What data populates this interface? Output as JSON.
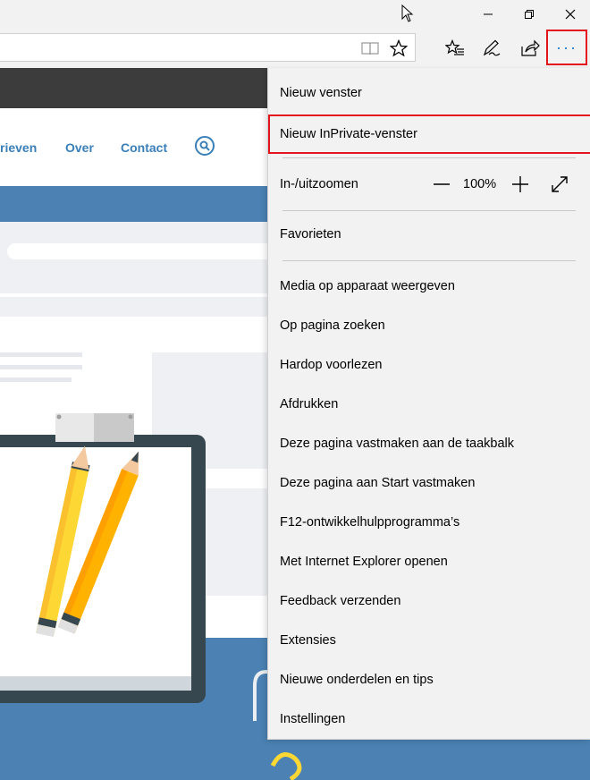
{
  "window": {
    "minimize_label": "Minimize",
    "restore_label": "Restore",
    "close_label": "Close"
  },
  "toolbar": {
    "more_label": "···"
  },
  "website": {
    "nav_links": [
      "rieven",
      "Over",
      "Contact"
    ]
  },
  "menu": {
    "items": {
      "new_window": "Nieuw venster",
      "new_inprivate": "Nieuw InPrivate-venster",
      "zoom_label": "In-/uitzoomen",
      "zoom_value": "100%",
      "favorites": "Favorieten",
      "cast_media": "Media op apparaat weergeven",
      "find_on_page": "Op pagina zoeken",
      "read_aloud": "Hardop voorlezen",
      "print": "Afdrukken",
      "pin_taskbar": "Deze pagina vastmaken aan de taakbalk",
      "pin_start": "Deze pagina aan Start vastmaken",
      "devtools": "F12-ontwikkelhulpprogramma’s",
      "open_ie": "Met Internet Explorer openen",
      "feedback": "Feedback verzenden",
      "extensions": "Extensies",
      "whats_new": "Nieuwe onderdelen en tips",
      "settings": "Instellingen"
    }
  },
  "colors": {
    "highlight_border": "#e3141b",
    "accent_blue": "#1976d2",
    "link_blue": "#3a7fb8",
    "menu_bg": "#f2f2f2"
  }
}
